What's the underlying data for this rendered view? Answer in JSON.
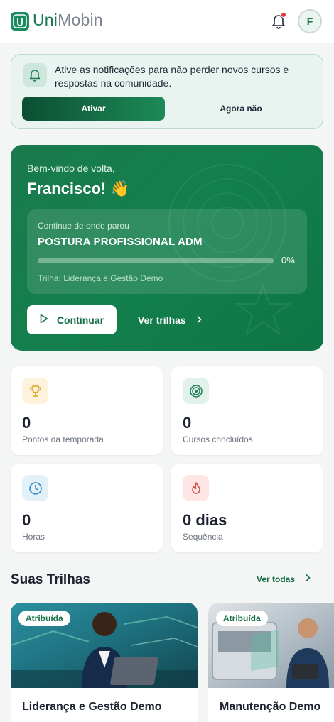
{
  "header": {
    "brand_strong": "Uni",
    "brand_light": "Mobin",
    "avatar_initial": "F",
    "icons": [
      "logo-icon",
      "bell-icon"
    ]
  },
  "notification": {
    "text": "Ative as notificações para não perder novos cursos e respostas na comunidade.",
    "activate_label": "Ativar",
    "later_label": "Agora não"
  },
  "hero": {
    "greeting": "Bem-vindo de volta,",
    "name": "Francisco! 👋",
    "continue_label": "Continue de onde parou",
    "course": "POSTURA PROFISSIONAL ADM",
    "progress_text": "0%",
    "progress": 0,
    "track": "Trilha: Liderança e Gestão Demo",
    "continue_button": "Continuar",
    "trails_button": "Ver trilhas"
  },
  "stats": [
    {
      "value": "0",
      "label": "Pontos da temporada",
      "icon": "trophy-icon",
      "color": "#e0a21b",
      "bg": "#fdf3dc"
    },
    {
      "value": "0",
      "label": "Cursos concluídos",
      "icon": "target-icon",
      "color": "#1b7a55",
      "bg": "#e2f1ea"
    },
    {
      "value": "0",
      "label": "Horas",
      "icon": "clock-icon",
      "color": "#2f86c2",
      "bg": "#e2f0f8"
    },
    {
      "value": "0 dias",
      "label": "Sequência",
      "icon": "flame-icon",
      "color": "#e0483e",
      "bg": "#fde6e4"
    }
  ],
  "trails_section": {
    "title": "Suas Trilhas",
    "see_all": "Ver todas"
  },
  "trails": [
    {
      "badge": "Atribuída",
      "title": "Liderança e Gestão Demo"
    },
    {
      "badge": "Atribuída",
      "title": "Manutenção Demo"
    }
  ],
  "colors": {
    "brand": "#1b7a55",
    "hero_bg": "#137f4c",
    "accent_red": "#e23a3a"
  }
}
